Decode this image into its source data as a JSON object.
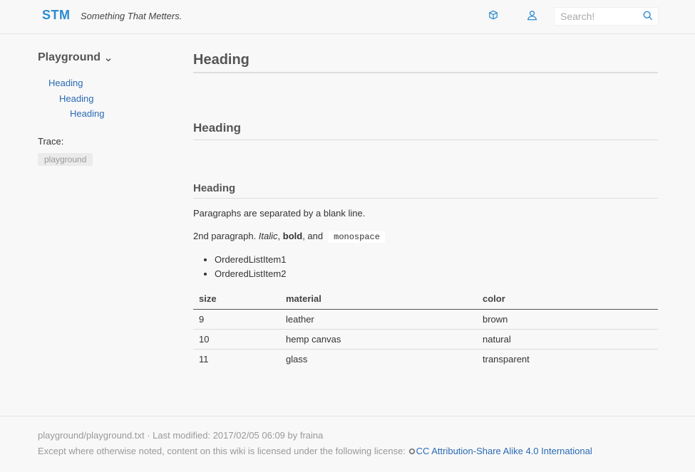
{
  "header": {
    "brand": "STM",
    "tagline": "Something That Metters.",
    "search_placeholder": "Search!",
    "colors": {
      "brand": "#2b8bd0",
      "icon": "#2b8bd0"
    },
    "icons": [
      "cube-icon",
      "user-icon",
      "search-icon"
    ]
  },
  "sidebar": {
    "title": "Playground",
    "toc": [
      {
        "label": "Heading",
        "level": 1
      },
      {
        "label": "Heading",
        "level": 2
      },
      {
        "label": "Heading",
        "level": 3
      }
    ],
    "trace_label": "Trace:",
    "trace_item": "playground"
  },
  "main": {
    "h1": "Heading",
    "h2": "Heading",
    "h3": "Heading",
    "para1": "Paragraphs are separated by a blank line.",
    "para2": {
      "prefix": "2nd paragraph. ",
      "italic": "Italic",
      "sep1": ", ",
      "bold": "bold",
      "sep2": ", and",
      "mono": "monospace"
    },
    "list": [
      "OrderedListItem1",
      "OrderedListItem2"
    ],
    "table": {
      "headers": [
        "size",
        "material",
        "color"
      ],
      "rows": [
        [
          "9",
          "leather",
          "brown"
        ],
        [
          "10",
          "hemp canvas",
          "natural"
        ],
        [
          "11",
          "glass",
          "transparent"
        ]
      ]
    }
  },
  "footer": {
    "line1": "playground/playground.txt · Last modified: 2017/02/05 06:09 by fraina",
    "line2_prefix": "Except where otherwise noted, content on this wiki is licensed under the following license: ",
    "license_link": "CC Attribution-Share Alike 4.0 International"
  }
}
